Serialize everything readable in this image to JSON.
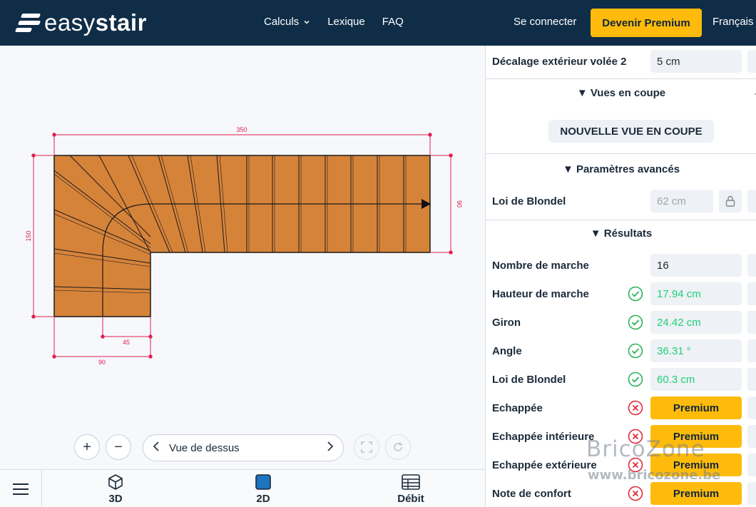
{
  "header": {
    "logo_light": "easy",
    "logo_bold": "stair",
    "nav": [
      {
        "label": "Calculs",
        "has_dropdown": true
      },
      {
        "label": "Lexique"
      },
      {
        "label": "FAQ"
      }
    ],
    "login": "Se connecter",
    "premium_button": "Devenir Premium",
    "language": "Français"
  },
  "drawing": {
    "dims": {
      "top": "350",
      "right": "90",
      "left": "150",
      "inner_bottom": "45",
      "outer_bottom": "90"
    },
    "colors": {
      "stair_fill": "#d6833a",
      "dimension": "#e0204f",
      "outline": "#1a1a1a"
    }
  },
  "controls": {
    "zoom_in": "+",
    "zoom_out": "−",
    "view_label": "Vue de dessus"
  },
  "bottom_tabs": [
    {
      "label": "3D",
      "icon": "cube-icon"
    },
    {
      "label": "2D",
      "icon": "square-icon",
      "active": true
    },
    {
      "label": "Débit",
      "icon": "table-icon"
    }
  ],
  "panel": {
    "top_row": {
      "label": "Décalage extérieur volée 2",
      "value": "5 cm"
    },
    "sections": {
      "views": "▼ Vues en coupe",
      "advanced": "▼ Paramètres avancés",
      "results": "▼ Résultats"
    },
    "new_view_button": "NOUVELLE VUE EN COUPE",
    "blondel_param": {
      "label": "Loi de Blondel",
      "value": "62 cm"
    },
    "results": [
      {
        "label": "Nombre de marche",
        "value": "16",
        "status": "none",
        "style": "normal"
      },
      {
        "label": "Hauteur de marche",
        "value": "17.94 cm",
        "status": "ok",
        "style": "green"
      },
      {
        "label": "Giron",
        "value": "24.42 cm",
        "status": "ok",
        "style": "green"
      },
      {
        "label": "Angle",
        "value": "36.31 °",
        "status": "ok",
        "style": "green"
      },
      {
        "label": "Loi de Blondel",
        "value": "60.3 cm",
        "status": "ok",
        "style": "green"
      },
      {
        "label": "Echappée",
        "value": "Premium",
        "status": "error",
        "style": "premium"
      },
      {
        "label": "Echappée intérieure",
        "value": "Premium",
        "status": "error",
        "style": "premium"
      },
      {
        "label": "Echappée extérieure",
        "value": "Premium",
        "status": "error",
        "style": "premium"
      },
      {
        "label": "Note de confort",
        "value": "Premium",
        "status": "error",
        "style": "premium"
      }
    ]
  },
  "watermark": {
    "line1": "BricoZone",
    "line2": "www.bricozone.be"
  }
}
